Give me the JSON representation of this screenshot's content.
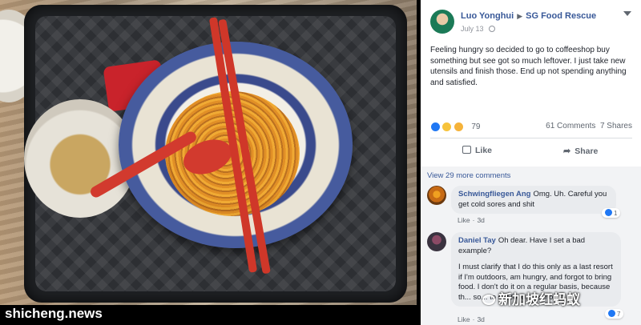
{
  "photo": {
    "watermark": "shicheng.news"
  },
  "post": {
    "author": "Luo Yonghui",
    "group": "SG Food Rescue",
    "date": "July 13",
    "body": "Feeling hungry so decided to go to coffeeshop buy something but see got so much leftover. I just take new utensils and finish those. End up not spending anything and satisfied.",
    "reactions_count": "79",
    "comments_count": "61 Comments",
    "shares_count": "7 Shares",
    "like_label": "Like",
    "share_label": "Share"
  },
  "comments": {
    "view_more": "View 29 more comments",
    "items": [
      {
        "name": "Schwingfliegen Ang",
        "text": "Omg. Uh. Careful you get cold sores and shit",
        "action": "Like",
        "time": "3d",
        "reaction_count": "1"
      },
      {
        "name": "Daniel Tay",
        "text": "Oh dear. Have I set a bad example?",
        "text2": "I must clarify that I do this only as a last resort if I'm outdoors, am hungry, and forgot to bring food. I don't do it on a regular basis, because th... so... to get food. ...e more",
        "action": "Like",
        "time": "3d",
        "reaction_count": "7"
      }
    ]
  },
  "overlay": {
    "watermark": "新加坡红蚂蚁"
  },
  "colors": {
    "fb_blue": "#385898",
    "tray": "#1f2124",
    "noodle": "#e08a1c",
    "utensil_red": "#cf3729"
  }
}
